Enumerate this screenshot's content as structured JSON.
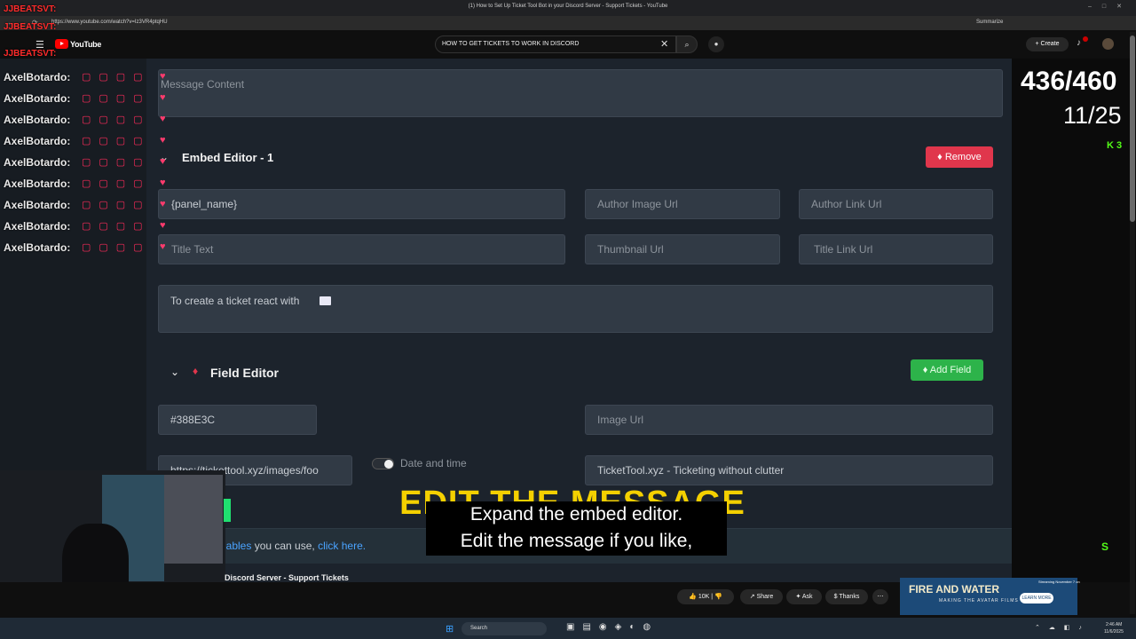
{
  "browser": {
    "tab_title": "(1) How to Set Up Ticket Tool Bot in your Discord Server - Support Tickets - YouTube",
    "url": "https://www.youtube.com/watch?v=Iz3VR4ptqHU",
    "summarize_label": "Summarize"
  },
  "youtube": {
    "logo_text": "YouTube",
    "search_value": "HOW TO GET TICKETS  TO WORK IN DISCORD",
    "create_label": "Create",
    "video_title": "Discord Server - Support Tickets",
    "actions": {
      "likes": "10K",
      "share": "Share",
      "ask": "Ask",
      "thanks": "Thanks"
    }
  },
  "editor": {
    "message_content_placeholder": "Message Content",
    "embed_title": "Embed Editor - 1",
    "remove_label": "Remove",
    "fields": {
      "panel_name": "{panel_name}",
      "author_image_url": "Author Image Url",
      "author_link_url": "Author Link Url",
      "title_text": "Title Text",
      "thumbnail_url": "Thumbnail Url",
      "title_link_url": "Title Link Url",
      "description": "To create a ticket react with",
      "color": "#388E3C",
      "image_url": "Image Url",
      "footer_icon": "https://tickettool.xyz/images/foo",
      "date_time_label": "Date and time",
      "footer_text": "TicketTool.xyz - Ticketing without clutter"
    },
    "field_editor_title": "Field Editor",
    "add_field_label": "Add Field",
    "variables_text_pre": "iables",
    "variables_text_mid": " you can use, ",
    "variables_link": "click here."
  },
  "stream_overlay": {
    "top_users": [
      "JJBEATSVT:",
      "JJBEATSVT:",
      "JJBEATSVT:"
    ],
    "chat_users": [
      "AxelBotardo:",
      "AxelBotardo:",
      "AxelBotardo:",
      "AxelBotardo:",
      "AxelBotardo:",
      "AxelBotardo:",
      "AxelBotardo:",
      "AxelBotardo:",
      "AxelBotardo:"
    ],
    "counter_main": "436/460",
    "counter_sub": "11/25",
    "kick_count": "3",
    "title_overlay": "EDIT THE MESSAGE",
    "caption_line1": "Expand the embed editor.",
    "caption_line2": "Edit the message if you like,"
  },
  "ad": {
    "title": "FIRE AND WATER",
    "subtitle": "MAKING THE AVATAR FILMS",
    "cta": "LEARN MORE",
    "streaming": "Streaming November 7 on"
  },
  "taskbar": {
    "search_label": "Search",
    "time": "2:46 AM",
    "date": "11/6/2025"
  },
  "colors": {
    "remove": "#e0364c",
    "add_field": "#2db34a",
    "overlay_yellow": "#f4d000",
    "kick_green": "#53fc18"
  }
}
